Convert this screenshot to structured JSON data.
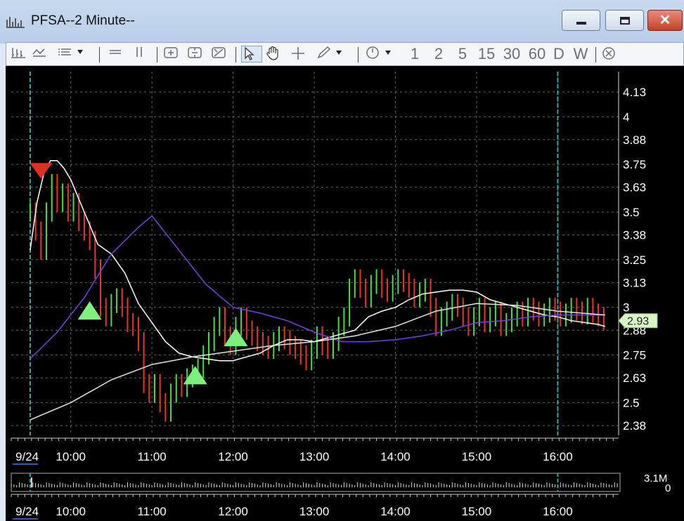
{
  "window": {
    "title": "PFSA--2 Minute--",
    "minimize_label": "minimize",
    "maximize_label": "maximize",
    "close_symbol": "✕"
  },
  "toolbar": {
    "items": [
      {
        "icon": "bar-chart-icon"
      },
      {
        "icon": "line-style-icon"
      },
      {
        "icon": "list-dropdown-icon"
      },
      {
        "icon": "horizontal-line-icon"
      },
      {
        "icon": "vertical-line-icon"
      },
      {
        "icon": "zoom-in-icon"
      },
      {
        "icon": "zoom-out-icon"
      },
      {
        "icon": "zoom-fit-icon"
      },
      {
        "icon": "pointer-icon",
        "selected": true
      },
      {
        "icon": "hand-icon"
      },
      {
        "icon": "crosshair-icon"
      },
      {
        "icon": "pencil-dropdown-icon"
      },
      {
        "icon": "clock-dropdown-icon"
      },
      {
        "icon": "stop-icon"
      }
    ],
    "intervals": [
      "1",
      "2",
      "5",
      "15",
      "30",
      "60",
      "D",
      "W"
    ]
  },
  "chart_data": {
    "type": "line",
    "symbol": "PFSA",
    "interval": "2 Minute",
    "last_price": "2.93",
    "x_tick_labels": [
      "9/24",
      "10:00",
      "11:00",
      "12:00",
      "13:00",
      "14:00",
      "15:00",
      "16:00"
    ],
    "y_tick_labels": [
      "4.13",
      "4",
      "3.88",
      "3.75",
      "3.63",
      "3.5",
      "3.38",
      "3.25",
      "3.13",
      "3",
      "2.88",
      "2.75",
      "2.63",
      "2.5",
      "2.38"
    ],
    "ylim": [
      2.35,
      4.2
    ],
    "volume_max_label": "3.1M",
    "volume_zero_label": "0",
    "series": [
      {
        "color": "#ffffff",
        "x": [
          "09:30",
          "09:35",
          "09:40",
          "09:45",
          "09:50",
          "09:55",
          "10:00",
          "10:10",
          "10:20",
          "10:30",
          "10:40",
          "10:50",
          "11:00",
          "11:10",
          "11:20",
          "11:30",
          "11:40",
          "11:50",
          "12:00",
          "12:10",
          "12:20",
          "12:30",
          "12:40",
          "12:50",
          "13:00",
          "13:10",
          "13:20",
          "13:30",
          "13:40",
          "13:50",
          "14:00",
          "14:10",
          "14:20",
          "14:30",
          "14:40",
          "14:50",
          "15:00",
          "15:10",
          "15:20",
          "15:30",
          "15:40",
          "15:50",
          "16:00",
          "16:10",
          "16:20",
          "16:30",
          "16:35"
        ],
        "values": [
          3.3,
          3.55,
          3.7,
          3.77,
          3.77,
          3.73,
          3.67,
          3.5,
          3.33,
          3.28,
          3.18,
          3.02,
          2.92,
          2.82,
          2.76,
          2.74,
          2.73,
          2.72,
          2.72,
          2.74,
          2.76,
          2.8,
          2.83,
          2.83,
          2.82,
          2.84,
          2.86,
          2.88,
          2.95,
          2.98,
          3.0,
          3.04,
          3.07,
          3.08,
          3.09,
          3.09,
          3.08,
          3.04,
          3.02,
          3.0,
          2.98,
          2.96,
          2.95,
          2.93,
          2.92,
          2.91,
          2.9
        ]
      },
      {
        "color": "#7a3fe0",
        "x": [
          "09:30",
          "09:50",
          "10:10",
          "10:30",
          "10:50",
          "11:00",
          "11:20",
          "11:40",
          "12:00",
          "12:20",
          "12:40",
          "13:00",
          "13:20",
          "13:40",
          "14:00",
          "14:20",
          "14:40",
          "15:00",
          "15:20",
          "15:40",
          "16:00",
          "16:20",
          "16:35"
        ],
        "values": [
          2.73,
          2.87,
          3.05,
          3.28,
          3.42,
          3.48,
          3.3,
          3.12,
          3.0,
          2.97,
          2.93,
          2.87,
          2.82,
          2.82,
          2.83,
          2.85,
          2.88,
          2.92,
          2.93,
          2.95,
          2.96,
          2.96,
          2.96
        ]
      },
      {
        "color": "#dfe8dc",
        "x": [
          "09:30",
          "10:00",
          "10:30",
          "11:00",
          "11:30",
          "12:00",
          "12:30",
          "13:00",
          "13:30",
          "14:00",
          "14:30",
          "15:00",
          "15:30",
          "16:00",
          "16:35"
        ],
        "values": [
          2.41,
          2.5,
          2.62,
          2.7,
          2.74,
          2.77,
          2.8,
          2.82,
          2.85,
          2.9,
          2.98,
          3.02,
          3.01,
          2.98,
          2.96
        ]
      },
      {
        "color": "#44dd44",
        "x": [
          "09:30",
          "09:34",
          "09:38",
          "09:42",
          "09:46",
          "09:50",
          "09:54",
          "09:58",
          "10:02",
          "10:06",
          "10:10",
          "10:14",
          "10:18",
          "10:22",
          "10:26",
          "10:30",
          "10:34",
          "10:38",
          "10:42",
          "10:46",
          "10:50",
          "10:54",
          "10:58",
          "11:02",
          "11:06",
          "11:10",
          "11:14",
          "11:18",
          "11:22",
          "11:26",
          "11:30",
          "11:34",
          "11:38",
          "11:42",
          "11:46",
          "11:50",
          "11:54",
          "11:58",
          "12:02",
          "12:06",
          "12:10",
          "12:14",
          "12:18",
          "12:22",
          "12:26",
          "12:30",
          "12:34",
          "12:38",
          "12:42",
          "12:46",
          "12:50",
          "12:54",
          "12:58",
          "13:02",
          "13:06",
          "13:10",
          "13:14",
          "13:18",
          "13:22",
          "13:26",
          "13:30",
          "13:34",
          "13:38",
          "13:42",
          "13:46",
          "13:50",
          "13:54",
          "13:58",
          "14:02",
          "14:06",
          "14:10",
          "14:14",
          "14:18",
          "14:22",
          "14:26",
          "14:30",
          "14:34",
          "14:38",
          "14:42",
          "14:46",
          "14:50",
          "14:54",
          "14:58",
          "15:02",
          "15:06",
          "15:10",
          "15:14",
          "15:18",
          "15:22",
          "15:26",
          "15:30",
          "15:34",
          "15:38",
          "15:42",
          "15:46",
          "15:50",
          "15:54",
          "15:58",
          "16:02",
          "16:06",
          "16:10",
          "16:14",
          "16:18",
          "16:22",
          "16:26",
          "16:30",
          "16:34"
        ],
        "values": [
          3.5,
          3.4,
          3.3,
          3.5,
          3.65,
          3.55,
          3.6,
          3.5,
          3.55,
          3.45,
          3.4,
          3.35,
          3.2,
          3.0,
          2.95,
          3.02,
          3.05,
          3.0,
          2.92,
          2.9,
          2.82,
          2.6,
          2.55,
          2.6,
          2.5,
          2.45,
          2.55,
          2.6,
          2.58,
          2.63,
          2.65,
          2.68,
          2.75,
          2.82,
          2.9,
          2.95,
          2.85,
          2.8,
          2.9,
          2.95,
          2.88,
          2.85,
          2.82,
          2.8,
          2.78,
          2.82,
          2.85,
          2.83,
          2.8,
          2.78,
          2.75,
          2.72,
          2.78,
          2.85,
          2.8,
          2.78,
          2.82,
          2.9,
          2.95,
          3.1,
          3.15,
          3.1,
          3.05,
          3.12,
          3.15,
          3.1,
          3.08,
          3.12,
          3.15,
          3.13,
          3.1,
          3.05,
          3.08,
          3.1,
          3.0,
          2.9,
          2.95,
          2.98,
          3.02,
          3.0,
          2.95,
          2.9,
          2.95,
          3.0,
          2.92,
          2.95,
          2.98,
          2.9,
          2.92,
          2.95,
          2.98,
          2.95,
          3.0,
          2.98,
          2.95,
          2.97,
          3.0,
          2.98,
          2.95,
          2.97,
          3.0,
          2.98,
          2.96,
          3.0,
          2.97,
          2.95,
          2.93
        ]
      }
    ],
    "signals": [
      {
        "type": "sell",
        "x": "09:38",
        "value": 3.72,
        "color": "#e03020"
      },
      {
        "type": "buy",
        "x": "10:14",
        "value": 2.98,
        "color": "#7df07d"
      },
      {
        "type": "buy",
        "x": "11:32",
        "value": 2.64,
        "color": "#7df07d"
      },
      {
        "type": "buy",
        "x": "12:02",
        "value": 2.84,
        "color": "#7df07d"
      }
    ],
    "session_lines": [
      "09:30",
      "16:00"
    ],
    "grid": true,
    "colors": {
      "up": "#44dd44",
      "down": "#ee3322",
      "background": "#000000",
      "axis_text": "#ffffff",
      "accent": "#2a5db0"
    }
  }
}
